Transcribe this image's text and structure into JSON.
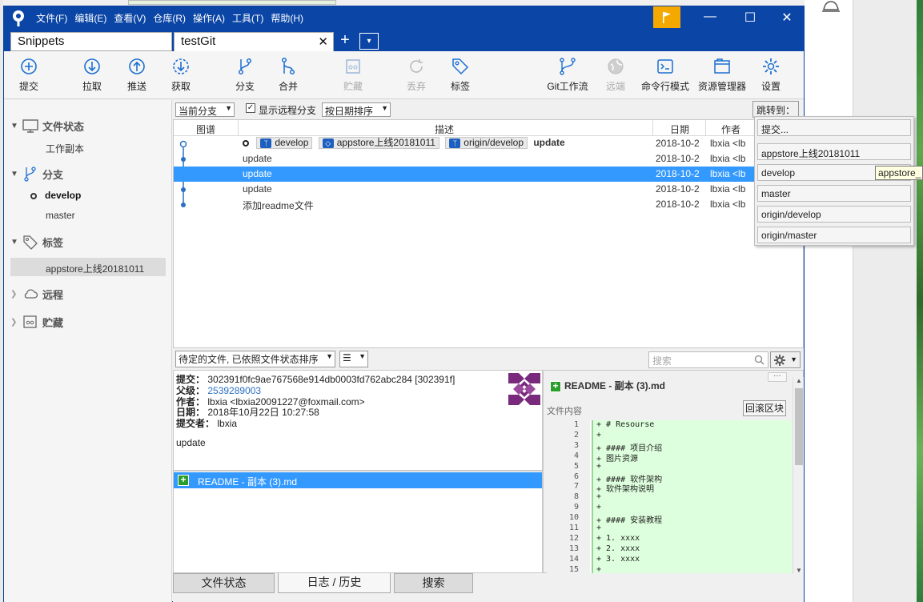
{
  "window": {
    "menu": [
      "文件(F)",
      "编辑(E)",
      "查看(V)",
      "仓库(R)",
      "操作(A)",
      "工具(T)",
      "帮助(H)"
    ],
    "tabs": [
      {
        "label": "Snippets"
      },
      {
        "label": "testGit"
      }
    ],
    "tab_close": "✕",
    "tab_add": "+",
    "tab_dropdown": "▾"
  },
  "toolbar": {
    "left": [
      {
        "label": "提交",
        "icon": "commit-icon"
      },
      {
        "label": "拉取",
        "icon": "pull-icon"
      },
      {
        "label": "推送",
        "icon": "push-icon"
      },
      {
        "label": "获取",
        "icon": "fetch-icon"
      },
      {
        "label": "分支",
        "icon": "branch-icon"
      },
      {
        "label": "合并",
        "icon": "merge-icon"
      },
      {
        "label": "贮藏",
        "icon": "stash-icon",
        "disabled": true
      },
      {
        "label": "丢弃",
        "icon": "discard-icon",
        "disabled": true
      },
      {
        "label": "标签",
        "icon": "tag-icon"
      }
    ],
    "right": [
      {
        "label": "Git工作流",
        "icon": "gitflow-icon"
      },
      {
        "label": "远端",
        "icon": "remote-icon",
        "disabled": true
      },
      {
        "label": "命令行模式",
        "icon": "terminal-icon"
      },
      {
        "label": "资源管理器",
        "icon": "explorer-icon"
      },
      {
        "label": "设置",
        "icon": "settings-icon"
      }
    ]
  },
  "sidebar": {
    "file_status": {
      "title": "文件状态",
      "items": [
        "工作副本"
      ]
    },
    "branches": {
      "title": "分支",
      "items": [
        "develop",
        "master"
      ],
      "current": "develop"
    },
    "tags": {
      "title": "标签",
      "items": [
        "appstore上线20181011"
      ]
    },
    "remotes": {
      "title": "远程"
    },
    "stashes": {
      "title": "贮藏"
    }
  },
  "filter": {
    "branch_select": "当前分支",
    "show_remote_label": "显示远程分支",
    "show_remote_checked": true,
    "sort_select": "按日期排序",
    "jump_to": "跳转到："
  },
  "log": {
    "columns": {
      "graph": "图谱",
      "desc": "描述",
      "date": "日期",
      "author": "作者"
    },
    "head_refs": [
      {
        "label": "develop",
        "kind": "branch"
      },
      {
        "label": "appstore上线20181011",
        "kind": "tag"
      },
      {
        "label": "origin/develop",
        "kind": "branch"
      }
    ],
    "rows": [
      {
        "desc": "update",
        "date": "2018-10-2",
        "author": "lbxia <lb",
        "bold": true
      },
      {
        "desc": "update",
        "date": "2018-10-2",
        "author": "lbxia <lb"
      },
      {
        "desc": "update",
        "date": "2018-10-2",
        "author": "lbxia <lb",
        "selected": true
      },
      {
        "desc": "update",
        "date": "2018-10-2",
        "author": "lbxia <lb"
      },
      {
        "desc": "添加readme文件",
        "date": "2018-10-2",
        "author": "lbxia <lb"
      }
    ]
  },
  "jump_menu": {
    "items": [
      "提交...",
      "appstore上线20181011",
      "develop",
      "master",
      "origin/develop",
      "origin/master"
    ],
    "tooltip": "appstore_"
  },
  "bottom": {
    "file_sort_select": "待定的文件, 已依照文件状态排序",
    "view_select": "☰",
    "search_placeholder": "搜索"
  },
  "commit_detail": {
    "commit_label": "提交：",
    "commit": "302391f0fc9ae767568e914db0003fd762abc284 [302391f]",
    "parent_label": "父级：",
    "parent": "2539289003",
    "author_label": "作者：",
    "author": "lbxia <lbxia20091227@foxmail.com>",
    "date_label": "日期：",
    "date": "2018年10月22日 10:27:58",
    "committer_label": "提交者：",
    "committer": "lbxia",
    "message": "update"
  },
  "changed_files": [
    "README - 副本 (3).md"
  ],
  "diff": {
    "title": "README - 副本 (3).md",
    "subtitle": "文件内容",
    "revert_label": "回滚区块",
    "more_label": "···",
    "lines": [
      {
        "n": "1",
        "t": "+ # Resourse"
      },
      {
        "n": "2",
        "t": "+"
      },
      {
        "n": "3",
        "t": "+ #### 项目介绍"
      },
      {
        "n": "4",
        "t": "+ 图片资源"
      },
      {
        "n": "5",
        "t": "+"
      },
      {
        "n": "6",
        "t": "+ #### 软件架构"
      },
      {
        "n": "7",
        "t": "+ 软件架构说明"
      },
      {
        "n": "8",
        "t": "+"
      },
      {
        "n": "9",
        "t": "+"
      },
      {
        "n": "10",
        "t": "+ #### 安装教程"
      },
      {
        "n": "11",
        "t": "+"
      },
      {
        "n": "12",
        "t": "+ 1. xxxx"
      },
      {
        "n": "13",
        "t": "+ 2. xxxx"
      },
      {
        "n": "14",
        "t": "+ 3. xxxx"
      },
      {
        "n": "15",
        "t": "+"
      }
    ]
  },
  "bottom_tabs": [
    {
      "label": "文件状态"
    },
    {
      "label": "日志 / 历史",
      "active": true
    },
    {
      "label": "搜索"
    }
  ],
  "colors": {
    "titlebar": "#0b46a6",
    "selection": "#3399ff",
    "flag": "#f5a800",
    "added": "#ddffdd"
  }
}
